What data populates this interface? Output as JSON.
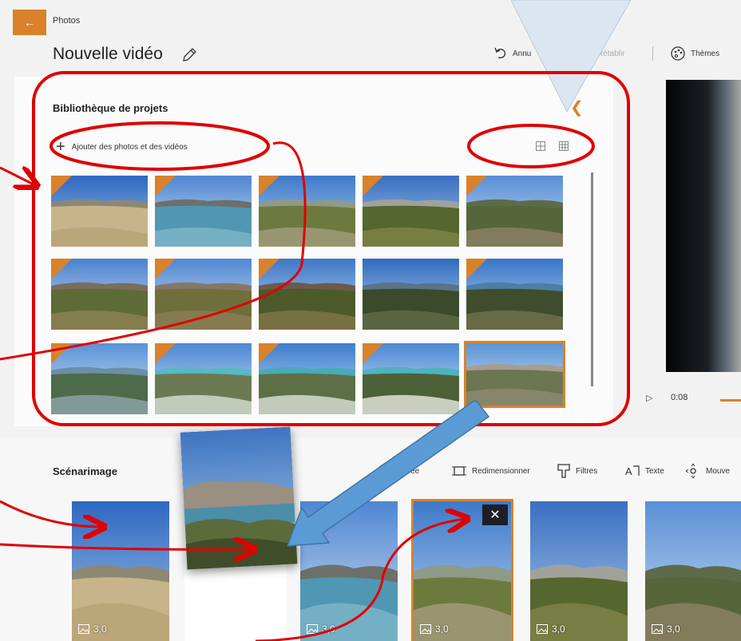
{
  "app": {
    "name": "Photos",
    "back_icon": "back-arrow-icon"
  },
  "project": {
    "title": "Nouvelle vidéo"
  },
  "toolbar": {
    "undo_label": "Annu",
    "redo_label": "Rétablir",
    "themes_label": "Thèmes"
  },
  "library": {
    "title": "Bibliothèque de projets",
    "add_label": "Ajouter des photos et des vidéos",
    "thumbnails": [
      {
        "scene": "beach-dune",
        "badge": true
      },
      {
        "scene": "sea-rocks",
        "badge": true
      },
      {
        "scene": "meadow-path",
        "badge": true
      },
      {
        "scene": "shrub-field",
        "badge": true
      },
      {
        "scene": "maquis-path",
        "badge": true
      },
      {
        "scene": "stone-hut",
        "badge": true
      },
      {
        "scene": "stone-hut-2",
        "badge": true
      },
      {
        "scene": "hut-shrubs",
        "badge": true
      },
      {
        "scene": "bay-scrub",
        "badge": false
      },
      {
        "scene": "sea-scrub",
        "badge": true
      },
      {
        "scene": "coast-view",
        "badge": true
      },
      {
        "scene": "turquoise-bay",
        "badge": true
      },
      {
        "scene": "turquoise-cove",
        "badge": true
      },
      {
        "scene": "white-beach",
        "badge": true
      },
      {
        "scene": "rocky-shore",
        "badge": false,
        "selected": true
      }
    ]
  },
  "preview": {
    "time": "0:08"
  },
  "storyboard": {
    "title": "Scénarimage",
    "tools": [
      "Durée",
      "Redimensionner",
      "Filtres",
      "Texte",
      "Mouve"
    ],
    "cards": [
      {
        "duration": "3,0",
        "scene": "beach-dune"
      },
      {
        "duration": "3,0",
        "scene": "sea-rocks"
      },
      {
        "duration": "3,0",
        "scene": "meadow-path",
        "selected": true
      },
      {
        "duration": "3,0",
        "scene": "shrub-field"
      },
      {
        "duration": "3,0",
        "scene": "maquis-path"
      }
    ],
    "close_icon": "close-icon"
  },
  "colors": {
    "accent": "#d9822b",
    "annotation": "#e00000",
    "arrow": "#5b9bd5"
  }
}
